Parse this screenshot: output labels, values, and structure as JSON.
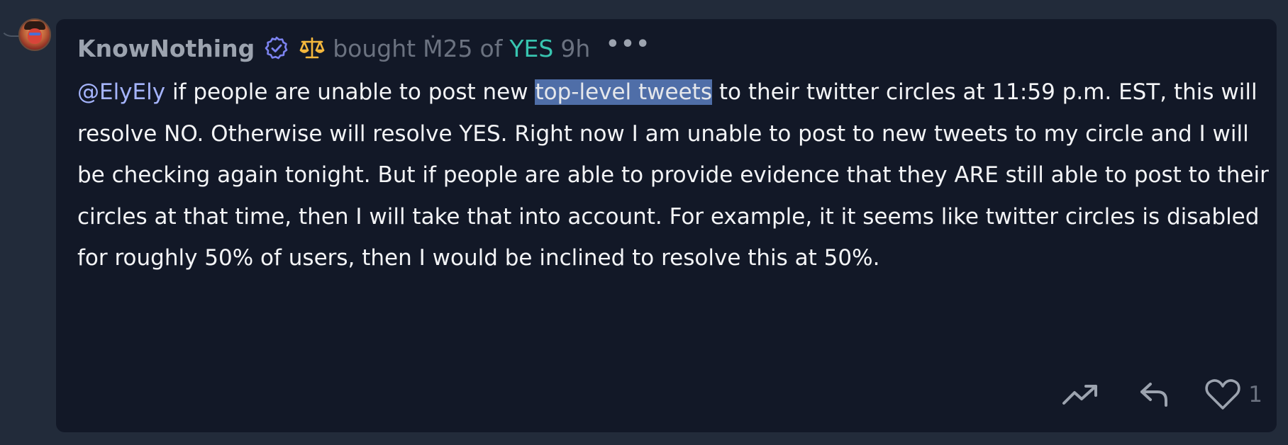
{
  "comment": {
    "username": "KnowNothing",
    "bet_verb": "bought",
    "bet_amount": "Ṁ25",
    "bet_of": "of",
    "bet_outcome": "YES",
    "time_ago": "9h",
    "more_label": "•••",
    "mention": "@ElyEly",
    "text_before_highlight": " if people are unable to post new ",
    "highlighted_text": "top-level tweets",
    "text_after_highlight": " to their twitter circles at 11:59 p.m. EST, this will resolve NO. Otherwise will resolve YES. Right now I am unable to post to new tweets to my circle and I will be checking again tonight. But if people are able to provide evidence that they ARE still able to post to their circles at that time, then I will take that into account. For example, it it seems like twitter circles is disabled for roughly 50% of users, then I would be inclined to resolve this at 50%.",
    "like_count": "1"
  },
  "icons": {
    "verified": "verified-check-icon",
    "bet": "scale-icon",
    "trend": "trending-up-icon",
    "reply": "reply-icon",
    "like": "heart-icon"
  },
  "colors": {
    "outcome_yes": "#38c5b0",
    "mention": "#a5b4fc",
    "highlight": "#4f6ea8",
    "verified": "#7c83f0",
    "bet_icon": "#f5b83d"
  }
}
